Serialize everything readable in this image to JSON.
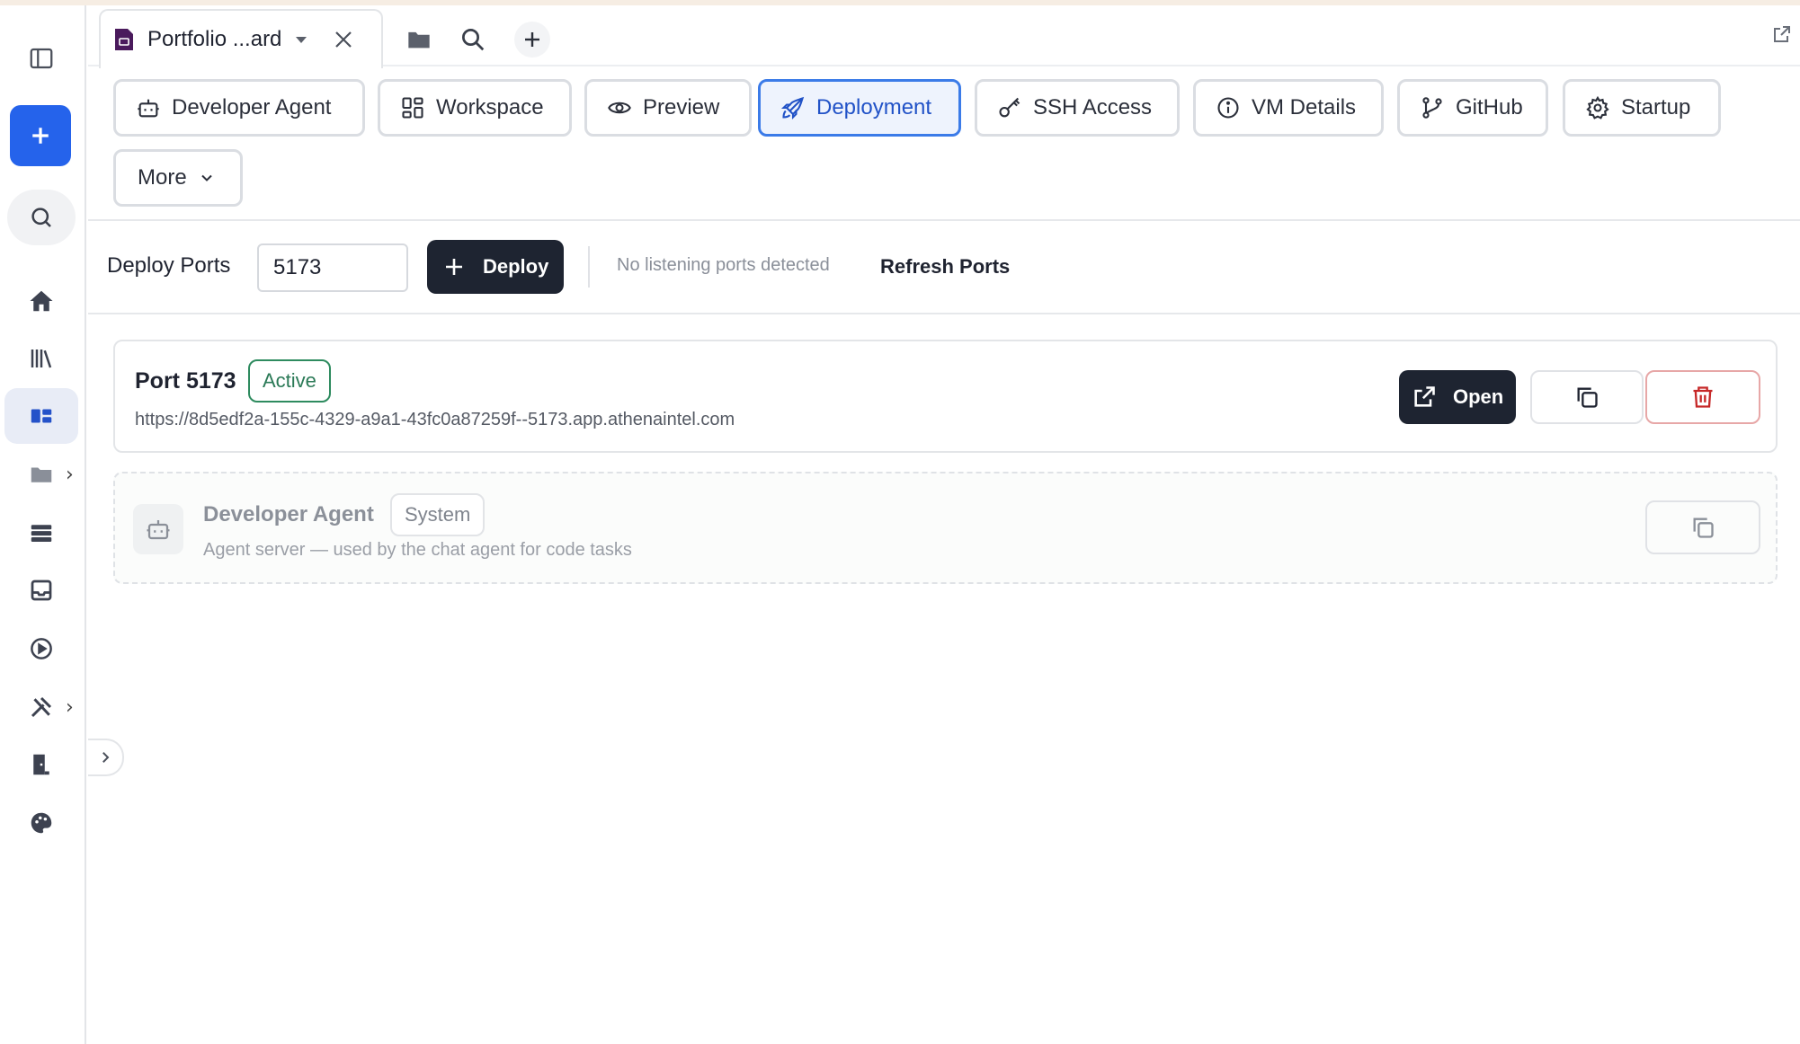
{
  "tab": {
    "title": "Portfolio ...ard"
  },
  "subtabs": [
    {
      "label": "Developer Agent",
      "icon": "robot-icon"
    },
    {
      "label": "Workspace",
      "icon": "grid-icon"
    },
    {
      "label": "Preview",
      "icon": "eye-icon"
    },
    {
      "label": "Deployment",
      "icon": "rocket-icon",
      "active": true
    },
    {
      "label": "SSH Access",
      "icon": "key-icon"
    },
    {
      "label": "VM Details",
      "icon": "info-icon"
    },
    {
      "label": "GitHub",
      "icon": "git-branch-icon"
    },
    {
      "label": "Startup",
      "icon": "gear-icon"
    },
    {
      "label": "More",
      "icon": "chevron-down-icon"
    }
  ],
  "deploy": {
    "label": "Deploy Ports",
    "port_value": "5173",
    "deploy_button": "Deploy",
    "status": "No listening ports detected",
    "refresh_label": "Refresh Ports"
  },
  "ports": [
    {
      "title": "Port 5173",
      "badge": "Active",
      "url": "https://8d5edf2a-155c-4329-a9a1-43fc0a87259f--5173.app.athenaintel.com",
      "open_label": "Open"
    }
  ],
  "agent": {
    "title": "Developer Agent",
    "badge": "System",
    "description": "Agent server — used by the chat agent for code tasks"
  },
  "colors": {
    "accent": "#2563eb",
    "dark_button": "#1e2431",
    "active_green": "#2e8b5f",
    "delete_red": "#c62828"
  }
}
